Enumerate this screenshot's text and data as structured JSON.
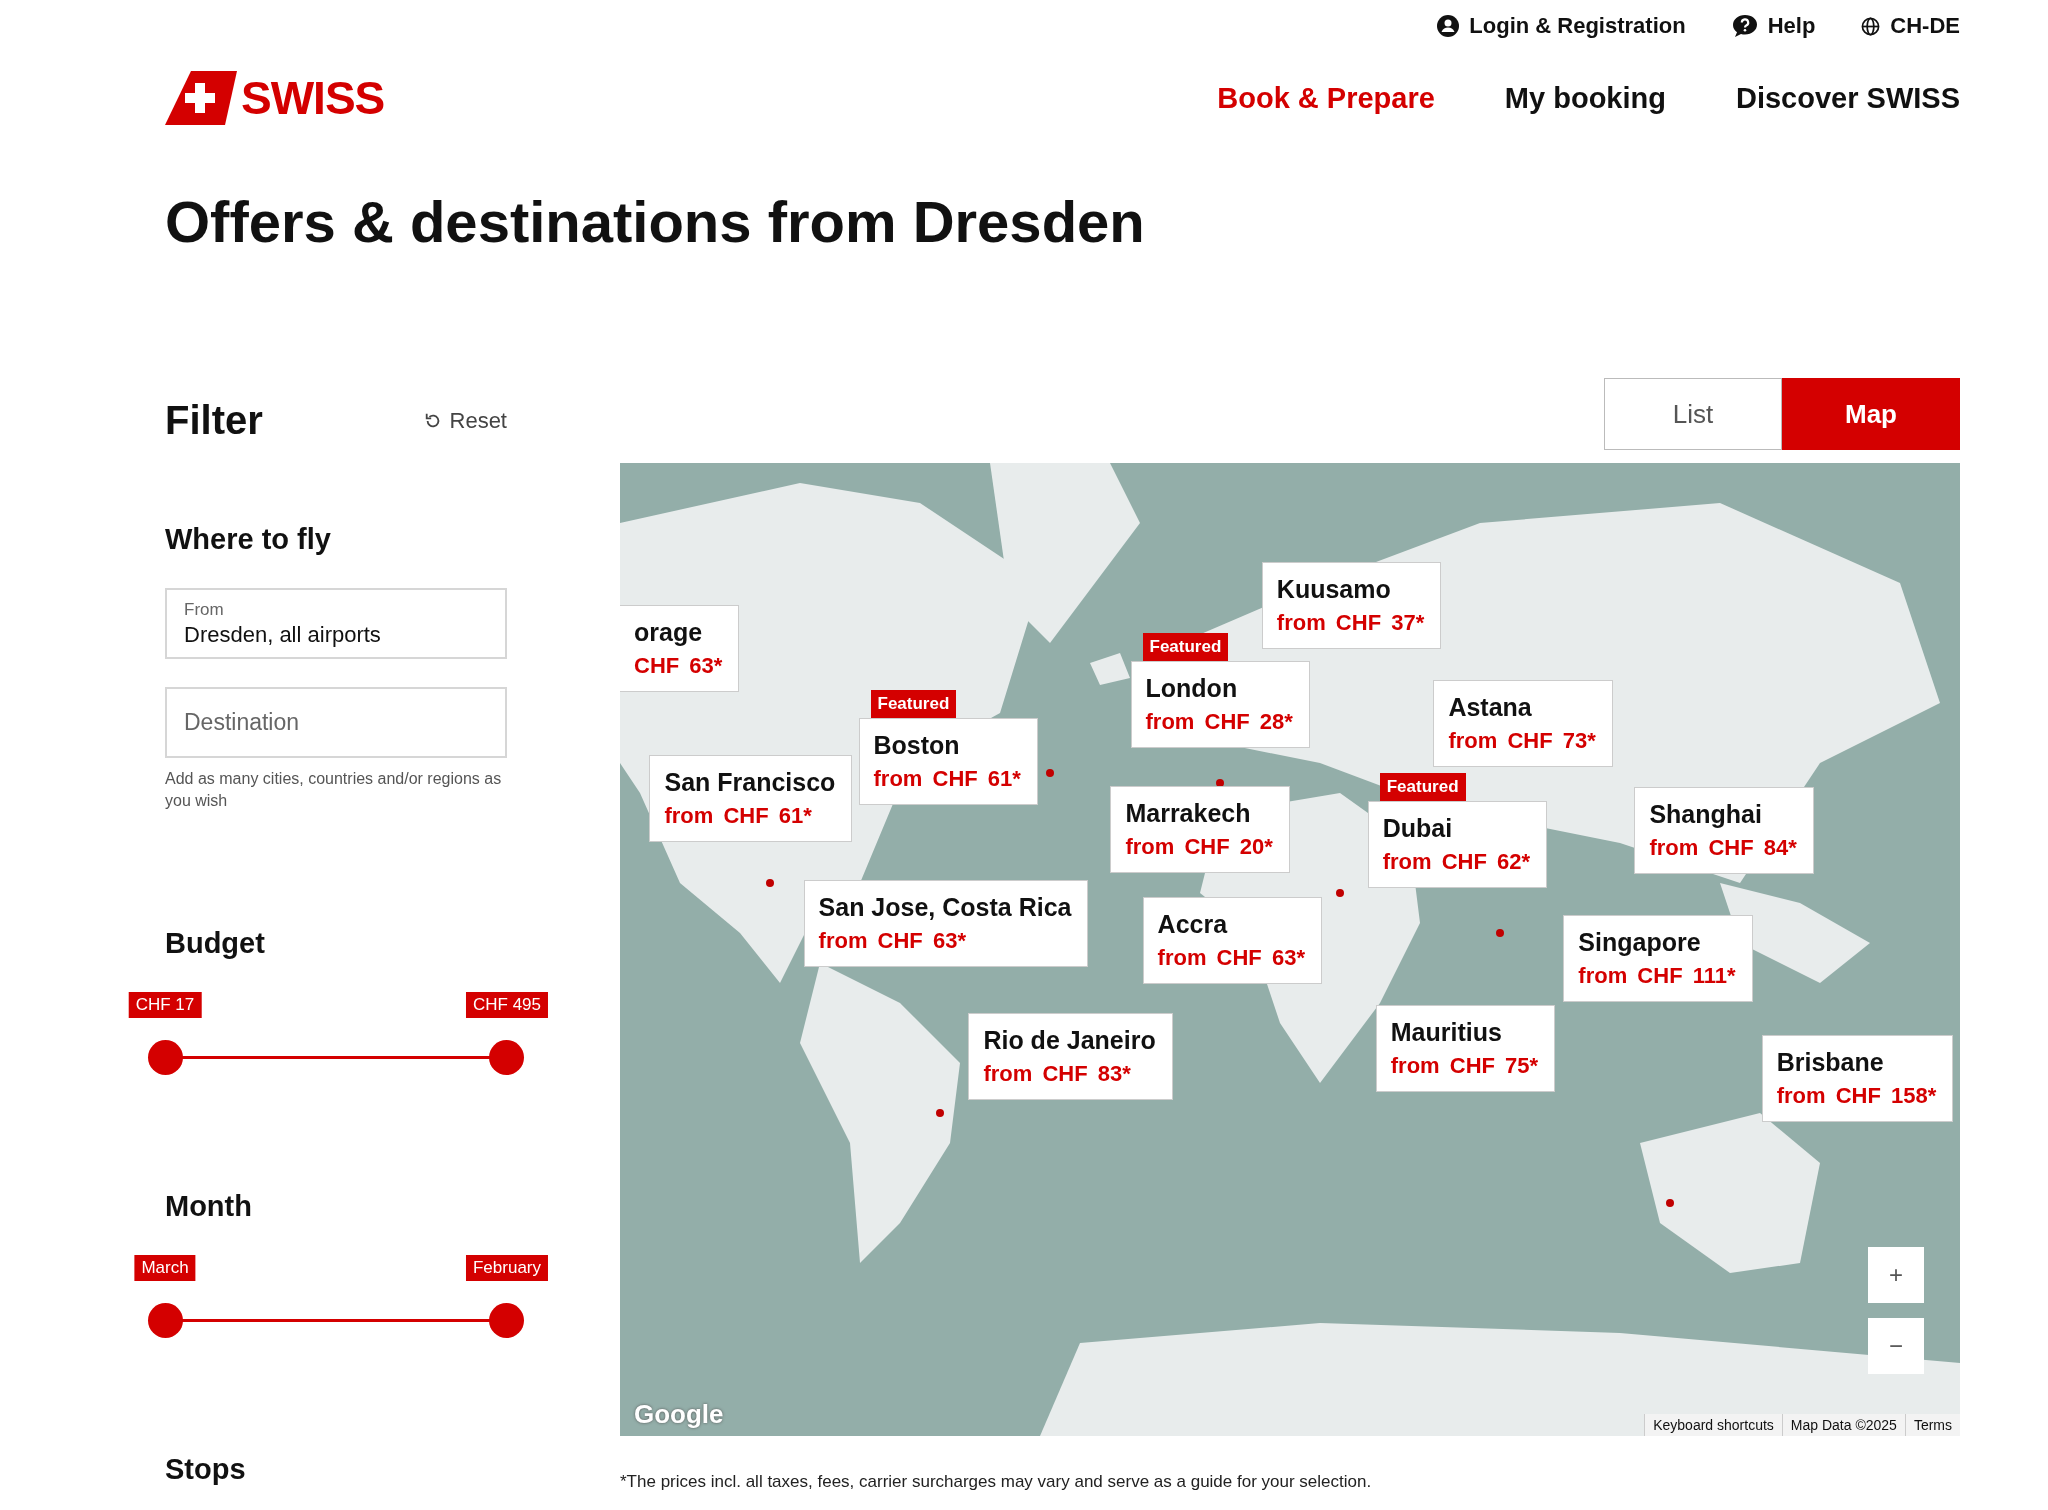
{
  "header": {
    "logo": "SWISS",
    "utility_links": [
      {
        "kind": "user",
        "label": "Login & Registration"
      },
      {
        "kind": "help",
        "label": "Help"
      },
      {
        "kind": "globe",
        "label": "CH-DE"
      }
    ],
    "nav": [
      {
        "label": "Book & Prepare",
        "selected": true
      },
      {
        "label": "My booking",
        "selected": false
      },
      {
        "label": "Discover SWISS",
        "selected": false
      }
    ]
  },
  "title": "Offers & destinations from Dresden",
  "filter": {
    "title": "Filter",
    "reset": "Reset",
    "where_to_fly": {
      "heading": "Where to fly",
      "from": {
        "label": "From",
        "value": "Dresden, all airports"
      },
      "destination": {
        "placeholder": "Destination"
      },
      "hint": "Add as many cities, countries and/or regions as you wish"
    },
    "budget": {
      "heading": "Budget",
      "start": {
        "label": "CHF 17",
        "level": 0
      },
      "end": {
        "label": "CHF 495",
        "level": 1
      }
    },
    "month": {
      "heading": "Month",
      "start": {
        "label": "March",
        "level": 0
      },
      "end": {
        "label": "February",
        "level": 1
      }
    },
    "stops": {
      "heading": "Stops"
    }
  },
  "view_tabs": [
    {
      "label": "List",
      "selected": false
    },
    {
      "label": "Map",
      "selected": true
    }
  ],
  "map": {
    "markers": [
      {
        "name": "orage",
        "price": "CHF 63*",
        "featured": false
      },
      {
        "name": "Kuusamo",
        "prefix": "from",
        "price": "CHF 37*",
        "featured": false
      },
      {
        "name": "San Francisco",
        "prefix": "from",
        "price": "CHF 61*",
        "featured": false
      },
      {
        "name": "Boston",
        "prefix": "from",
        "price": "CHF 61*",
        "featured": true,
        "badge": "Featured"
      },
      {
        "name": "London",
        "prefix": "from",
        "price": "CHF 28*",
        "featured": true,
        "badge": "Featured"
      },
      {
        "name": "Astana",
        "prefix": "from",
        "price": "CHF 73*",
        "featured": false
      },
      {
        "name": "Marrakech",
        "prefix": "from",
        "price": "CHF 20*",
        "featured": false
      },
      {
        "name": "Dubai",
        "prefix": "from",
        "price": "CHF 62*",
        "featured": true,
        "badge": "Featured"
      },
      {
        "name": "Shanghai",
        "prefix": "from",
        "price": "CHF 84*",
        "featured": false
      },
      {
        "name": "San Jose, Costa Rica",
        "prefix": "from",
        "price": "CHF 63*",
        "featured": false
      },
      {
        "name": "Accra",
        "prefix": "from",
        "price": "CHF 63*",
        "featured": false
      },
      {
        "name": "Singapore",
        "prefix": "from",
        "price": "CHF 111*",
        "featured": false
      },
      {
        "name": "Rio de Janeiro",
        "prefix": "from",
        "price": "CHF 83*",
        "featured": false
      },
      {
        "name": "Mauritius",
        "prefix": "from",
        "price": "CHF 75*",
        "featured": false
      },
      {
        "name": "Brisbane",
        "prefix": "from",
        "price": "CHF 158*",
        "featured": false
      }
    ],
    "zoom_in": "+",
    "zoom_out": "−",
    "provider": "Google",
    "attribution": [
      "Keyboard shortcuts",
      "Map Data ©2025",
      "Terms"
    ]
  },
  "footnote": "*The prices incl. all taxes, fees, carrier surcharges may vary and serve as a guide for your selection."
}
